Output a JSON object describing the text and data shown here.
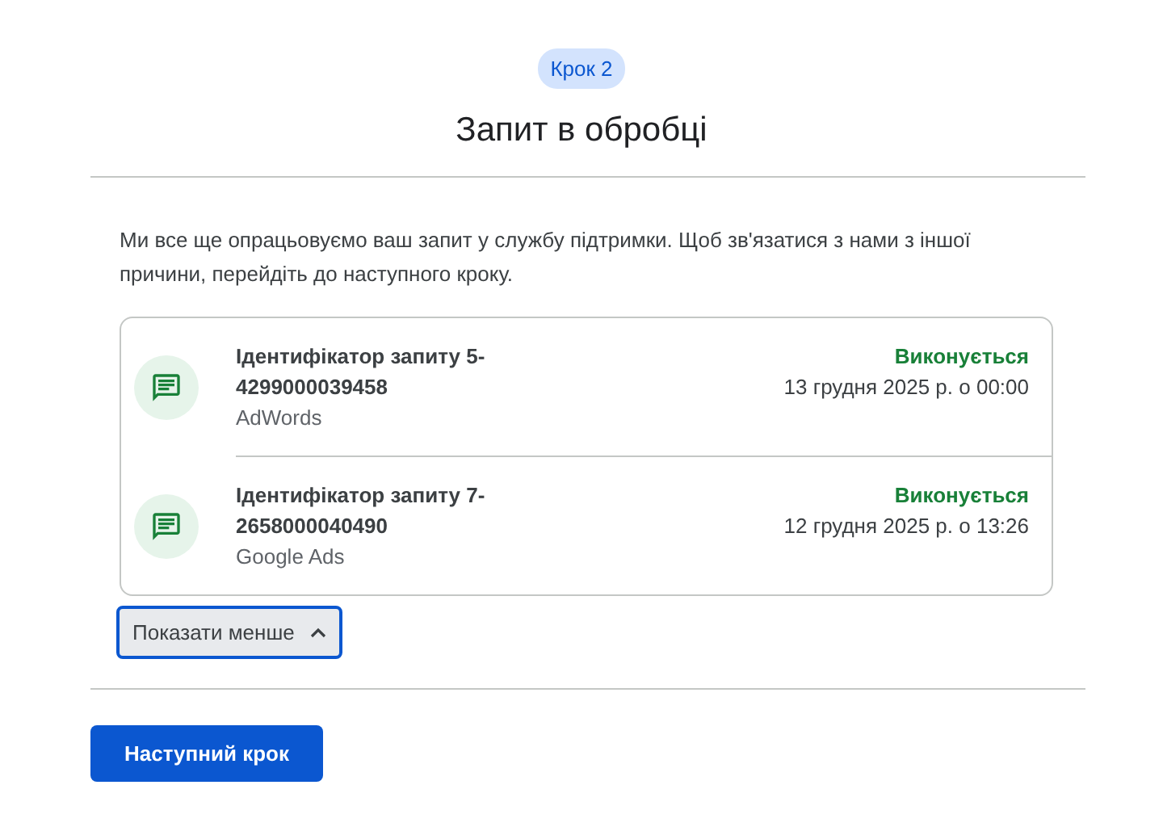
{
  "step": "Крок 2",
  "title": "Запит в обробці",
  "message": "Ми все ще опрацьовуємо ваш запит у службу підтримки. Щоб зв'язатися з нами з іншої причини, перейдіть до наступного кроку.",
  "requests": [
    {
      "id": "Ідентифікатор запиту 5-4299000039458",
      "product": "AdWords",
      "status": "Виконується",
      "date": "13 грудня 2025 р. о 00:00"
    },
    {
      "id": "Ідентифікатор запиту 7-2658000040490",
      "product": "Google Ads",
      "status": "Виконується",
      "date": "12 грудня 2025 р. о 13:26"
    }
  ],
  "toggle": {
    "label": "Показати менше",
    "expanded": true
  },
  "next_button": "Наступний крок"
}
